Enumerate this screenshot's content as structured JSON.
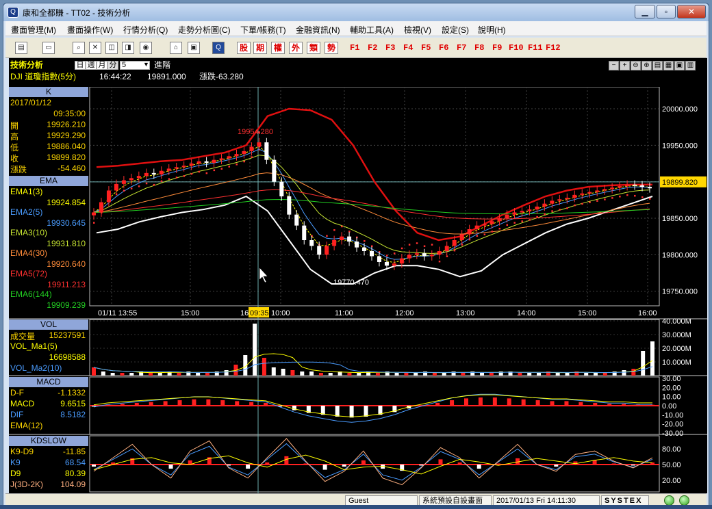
{
  "window": {
    "title": "康和全都賺 - TT02 - 技術分析",
    "min": "▁",
    "max": "▫",
    "close": "✕",
    "app_icon": "Q"
  },
  "menu": [
    "畫面管理(M)",
    "畫面操作(W)",
    "行情分析(Q)",
    "走勢分析圖(C)",
    "下單/帳務(T)",
    "金融資訊(N)",
    "輔助工具(A)",
    "檢視(V)",
    "設定(S)",
    "說明(H)"
  ],
  "toolbar": {
    "icons": [
      "chart-icon",
      "monitor-icon",
      "search-icon",
      "close-window-icon",
      "split-icon",
      "spin-icon",
      "cycle-icon",
      "disk-icon",
      "window-icon",
      "logo-icon"
    ],
    "quick": [
      "股",
      "期",
      "權",
      "外",
      "類",
      "勢"
    ],
    "fkeys": [
      "F1",
      "F2",
      "F3",
      "F4",
      "F5",
      "F6",
      "F7",
      "F8",
      "F9",
      "F10",
      "F11",
      "F12"
    ]
  },
  "chart_header": {
    "section": "技術分析",
    "periods": [
      "日",
      "週",
      "月",
      "分"
    ],
    "active_period": "分",
    "interval": "5",
    "advanced": "進階",
    "symbol": "DJI  道瓊指數(5分)",
    "time": "16:44:22",
    "price": "19891.000",
    "change": "漲跌-63.280"
  },
  "right_buttons": [
    "−",
    "+",
    "⊖",
    "⊕",
    "▤",
    "▦",
    "▣",
    "▥"
  ],
  "k_panel": {
    "title": "K",
    "date": "2017/01/12",
    "time": "09:35:00",
    "rows": [
      {
        "label": "開",
        "value": "19926.210"
      },
      {
        "label": "高",
        "value": "19929.290"
      },
      {
        "label": "低",
        "value": "19886.040"
      },
      {
        "label": "收",
        "value": "19899.820"
      },
      {
        "label": "漲跌",
        "value": "-54.460"
      }
    ]
  },
  "ema_panel": {
    "title": "EMA",
    "rows": [
      {
        "label": "EMA1(3)",
        "value": "19924.854",
        "color": "#ffff00"
      },
      {
        "label": "EMA2(5)",
        "value": "19930.645",
        "color": "#4a9cff"
      },
      {
        "label": "EMA3(10)",
        "value": "19931.810",
        "color": "#c8e632"
      },
      {
        "label": "EMA4(30)",
        "value": "19920.640",
        "color": "#ff8c3a"
      },
      {
        "label": "EMA5(72)",
        "value": "19911.213",
        "color": "#ff3030"
      },
      {
        "label": "EMA6(144)",
        "value": "19909.239",
        "color": "#22d022"
      }
    ]
  },
  "vol_panel": {
    "title": "VOL",
    "rows": [
      {
        "label": "成交量",
        "value": "15237591"
      },
      {
        "label": "VOL_Ma1(5)",
        "value": "16698588"
      },
      {
        "label": "VOL_Ma2(10)",
        "value": ""
      }
    ]
  },
  "macd_panel": {
    "title": "MACD",
    "rows": [
      {
        "label": "D-F",
        "value": "-1.1332"
      },
      {
        "label": "MACD",
        "value": "9.6515"
      },
      {
        "label": "DIF",
        "value": "8.5182"
      },
      {
        "label": "EMA(12)",
        "value": ""
      }
    ]
  },
  "kd_panel": {
    "title": "KDSLOW",
    "rows": [
      {
        "label": "K9-D9",
        "value": "-11.85"
      },
      {
        "label": "K9",
        "value": "68.54"
      },
      {
        "label": "D9",
        "value": "80.39"
      },
      {
        "label": "J(3D-2K)",
        "value": "104.09"
      }
    ]
  },
  "price_axis": [
    "20000.000",
    "19950.000",
    "19900.000",
    "19850.000",
    "19800.000",
    "19750.000"
  ],
  "time_axis": [
    "01/11 13:55",
    "15:00",
    "16",
    "10:00",
    "11:00",
    "12:00",
    "13:00",
    "14:00",
    "15:00",
    "16:00"
  ],
  "cursor_time": "09:35",
  "current_price_tag": "19899.820",
  "annotations": {
    "high": "19954.280",
    "low": "19770.470"
  },
  "vol_axis": [
    "40.000M",
    "30.000M",
    "20.000M",
    "10.000M"
  ],
  "macd_axis": [
    "30.00",
    "20.00",
    "10.00",
    "0.00",
    "-10.00",
    "-20.00",
    "-30.00"
  ],
  "kd_axis": [
    "80.00",
    "50.00",
    "20.00"
  ],
  "status": {
    "user": "Guest",
    "layout": "系統預設自設畫面",
    "datetime": "2017/01/13 Fri 14:11:30",
    "brand": "SYSTEX"
  },
  "chart_data": {
    "type": "candlestick",
    "ylim": [
      19730,
      20030
    ],
    "ema_labels": [
      "EMA1(3)",
      "EMA2(5)",
      "EMA3(10)",
      "EMA4(30)",
      "EMA5(72)",
      "EMA6(144)"
    ],
    "close_series": [
      19858,
      19872,
      19888,
      19897,
      19902,
      19905,
      19908,
      19912,
      19910,
      19915,
      19918,
      19920,
      19922,
      19925,
      19928,
      19926,
      19930,
      19932,
      19935,
      19938,
      19942,
      19948,
      19954,
      19930,
      19900,
      19880,
      19855,
      19840,
      19820,
      19812,
      19800,
      19812,
      19820,
      19825,
      19818,
      19810,
      19805,
      19798,
      19790,
      19785,
      19788,
      19795,
      19800,
      19802,
      19798,
      19800,
      19805,
      19812,
      19820,
      19828,
      19835,
      19840,
      19842,
      19846,
      19850,
      19855,
      19858,
      19860,
      19862,
      19866,
      19870,
      19874,
      19876,
      19878,
      19882,
      19884,
      19886,
      19888,
      19890,
      19892,
      19894,
      19896,
      19895,
      19893,
      19891
    ],
    "bollinger_upper": [
      19920,
      19922,
      19925,
      19928,
      19930,
      19935,
      19940,
      19950,
      19990,
      20000,
      19998,
      19985,
      19950,
      19900,
      19860,
      19830,
      19820,
      19825,
      19840,
      19855,
      19868,
      19880,
      19888,
      19893,
      19895,
      19896,
      19896
    ],
    "bollinger_lower": [
      19830,
      19835,
      19845,
      19852,
      19858,
      19862,
      19868,
      19880,
      19860,
      19820,
      19780,
      19760,
      19760,
      19775,
      19785,
      19785,
      19780,
      19770,
      19778,
      19800,
      19815,
      19830,
      19842,
      19850,
      19860,
      19870,
      19880
    ],
    "volume_M": [
      6,
      3,
      2,
      2,
      2,
      3,
      2,
      2,
      3,
      2,
      3,
      2,
      2,
      3,
      4,
      8,
      15,
      38,
      13,
      6,
      5,
      4,
      3,
      3,
      2,
      2,
      3,
      2,
      2,
      3,
      2,
      3,
      2,
      2,
      2,
      3,
      2,
      2,
      3,
      2,
      3,
      2,
      2,
      3,
      3,
      2,
      2,
      2,
      3,
      2,
      2,
      3,
      2,
      2,
      2,
      3,
      4,
      5,
      18,
      25
    ],
    "macd_hist": [
      -1,
      1,
      2,
      3,
      4,
      5,
      6,
      7,
      7,
      6,
      5,
      4,
      3,
      -1,
      -5,
      -8,
      -10,
      -12,
      -13,
      -12,
      -10,
      -7,
      -3,
      0,
      3,
      6,
      8,
      9,
      9,
      8,
      7,
      6,
      5,
      5,
      4,
      3,
      2,
      2,
      1,
      1
    ],
    "kd_k": [
      40,
      60,
      80,
      50,
      30,
      70,
      85,
      45,
      30,
      60,
      90,
      55,
      25,
      40,
      70,
      30,
      20,
      45,
      75,
      60,
      30,
      55,
      80,
      50,
      40,
      65,
      70,
      55,
      45,
      60
    ]
  }
}
